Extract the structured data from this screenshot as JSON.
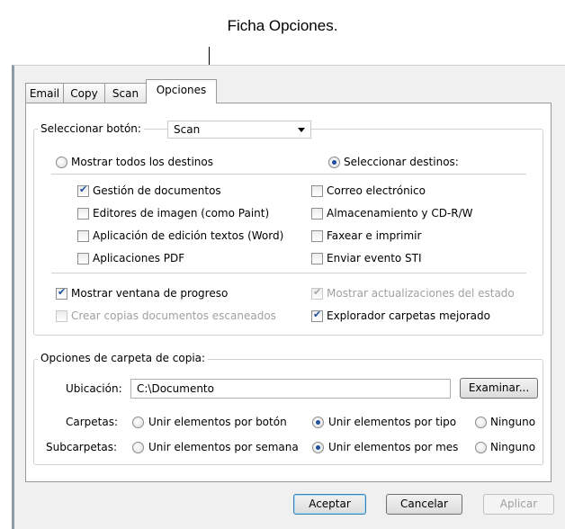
{
  "callout": "Ficha Opciones.",
  "tabs": [
    "Email",
    "Copy",
    "Scan",
    "Opciones"
  ],
  "select_button": {
    "label": "Seleccionar botón:",
    "value": "Scan"
  },
  "dest_mode": {
    "show_all": "Mostrar todos los destinos",
    "select": "Seleccionar destinos:",
    "selected": "select"
  },
  "destinations": [
    {
      "label": "Gestión de documentos",
      "checked": true
    },
    {
      "label": "Editores de imagen (como Paint)",
      "checked": false
    },
    {
      "label": "Aplicación de edición textos (Word)",
      "checked": false
    },
    {
      "label": "Aplicaciones PDF",
      "checked": false
    },
    {
      "label": "Correo electrónico",
      "checked": false
    },
    {
      "label": "Almacenamiento y CD-R/W",
      "checked": false
    },
    {
      "label": "Faxear e imprimir",
      "checked": false
    },
    {
      "label": "Enviar evento STI",
      "checked": false
    }
  ],
  "options": [
    {
      "label": "Mostrar ventana de progreso",
      "checked": true,
      "disabled": false
    },
    {
      "label": "Crear copias documentos escaneados",
      "checked": false,
      "disabled": true
    },
    {
      "label": "Mostrar actualizaciones del estado",
      "checked": true,
      "disabled": true
    },
    {
      "label": "Explorador carpetas mejorado",
      "checked": true,
      "disabled": false
    }
  ],
  "copy_folder": {
    "group_label": "Opciones de carpeta de copia:",
    "location_label": "Ubicación:",
    "location_value": "C:\\Documento",
    "browse": "Examinar...",
    "folders_label": "Carpetas:",
    "folders_options": [
      "Unir elementos por botón",
      "Unir elementos por tipo",
      "Ninguno"
    ],
    "folders_selected": 1,
    "subfolders_label": "Subcarpetas:",
    "subfolders_options": [
      "Unir elementos por semana",
      "Unir elementos por mes",
      "Ninguno"
    ],
    "subfolders_selected": 1
  },
  "buttons": {
    "ok": "Aceptar",
    "cancel": "Cancelar",
    "apply": "Aplicar"
  },
  "colors": {
    "accent": "#1d4f9e",
    "disabled_text": "#a0a0a0",
    "window_bg": "#f0f0f0"
  }
}
